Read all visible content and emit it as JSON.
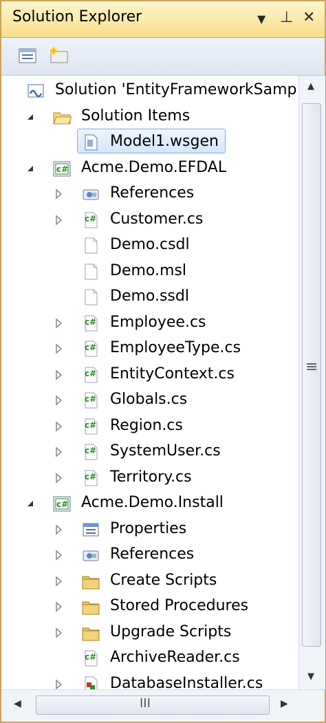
{
  "window": {
    "title": "Solution Explorer",
    "buttons": {
      "dropdown": "▼",
      "pin": "⊥",
      "close": "✕"
    }
  },
  "toolbar": {
    "items": [
      {
        "name": "properties-icon"
      },
      {
        "name": "new-folder-icon"
      }
    ]
  },
  "tree": {
    "rows": [
      {
        "label": "Solution 'EntityFrameworkSamp",
        "icon": "solution-icon",
        "arrow": "none",
        "indent": 0
      },
      {
        "label": "Solution Items",
        "icon": "folder-open-icon",
        "arrow": "expanded",
        "indent": 1
      },
      {
        "label": "Model1.wsgen",
        "icon": "file-icon",
        "arrow": "none",
        "indent": 2,
        "selected": true
      },
      {
        "label": "Acme.Demo.EFDAL",
        "icon": "csharp-project-icon",
        "arrow": "expanded",
        "indent": 1
      },
      {
        "label": "References",
        "icon": "references-icon",
        "arrow": "collapsed",
        "indent": 2
      },
      {
        "label": "Customer.cs",
        "icon": "csharp-file-icon",
        "arrow": "collapsed",
        "indent": 2
      },
      {
        "label": "Demo.csdl",
        "icon": "document-icon",
        "arrow": "none",
        "indent": 2
      },
      {
        "label": "Demo.msl",
        "icon": "document-icon",
        "arrow": "none",
        "indent": 2
      },
      {
        "label": "Demo.ssdl",
        "icon": "document-icon",
        "arrow": "none",
        "indent": 2
      },
      {
        "label": "Employee.cs",
        "icon": "csharp-file-icon",
        "arrow": "collapsed",
        "indent": 2
      },
      {
        "label": "EmployeeType.cs",
        "icon": "csharp-file-icon",
        "arrow": "collapsed",
        "indent": 2
      },
      {
        "label": "EntityContext.cs",
        "icon": "csharp-file-icon",
        "arrow": "collapsed",
        "indent": 2
      },
      {
        "label": "Globals.cs",
        "icon": "csharp-file-icon",
        "arrow": "collapsed",
        "indent": 2
      },
      {
        "label": "Region.cs",
        "icon": "csharp-file-icon",
        "arrow": "collapsed",
        "indent": 2
      },
      {
        "label": "SystemUser.cs",
        "icon": "csharp-file-icon",
        "arrow": "collapsed",
        "indent": 2
      },
      {
        "label": "Territory.cs",
        "icon": "csharp-file-icon",
        "arrow": "collapsed",
        "indent": 2
      },
      {
        "label": "Acme.Demo.Install",
        "icon": "csharp-project-icon",
        "arrow": "expanded",
        "indent": 1
      },
      {
        "label": "Properties",
        "icon": "properties-icon",
        "arrow": "collapsed",
        "indent": 2
      },
      {
        "label": "References",
        "icon": "references-icon",
        "arrow": "collapsed",
        "indent": 2
      },
      {
        "label": "Create Scripts",
        "icon": "folder-icon",
        "arrow": "collapsed",
        "indent": 2
      },
      {
        "label": "Stored Procedures",
        "icon": "folder-icon",
        "arrow": "collapsed",
        "indent": 2
      },
      {
        "label": "Upgrade Scripts",
        "icon": "folder-icon",
        "arrow": "collapsed",
        "indent": 2
      },
      {
        "label": "ArchiveReader.cs",
        "icon": "csharp-file-icon",
        "arrow": "none",
        "indent": 2
      },
      {
        "label": "DatabaseInstaller.cs",
        "icon": "installer-class-icon",
        "arrow": "collapsed",
        "indent": 2
      }
    ]
  },
  "scrollbars": {
    "vertical": {
      "up": "▲",
      "down": "▼",
      "grip": "≡"
    },
    "horizontal": {
      "left": "◀",
      "right": "▶",
      "grip": "III"
    }
  },
  "colors": {
    "title_bar": "#f7de8a",
    "selection": "#d5e6fb",
    "csharp_green": "#2f8a2f",
    "folder": "#e9c465"
  }
}
